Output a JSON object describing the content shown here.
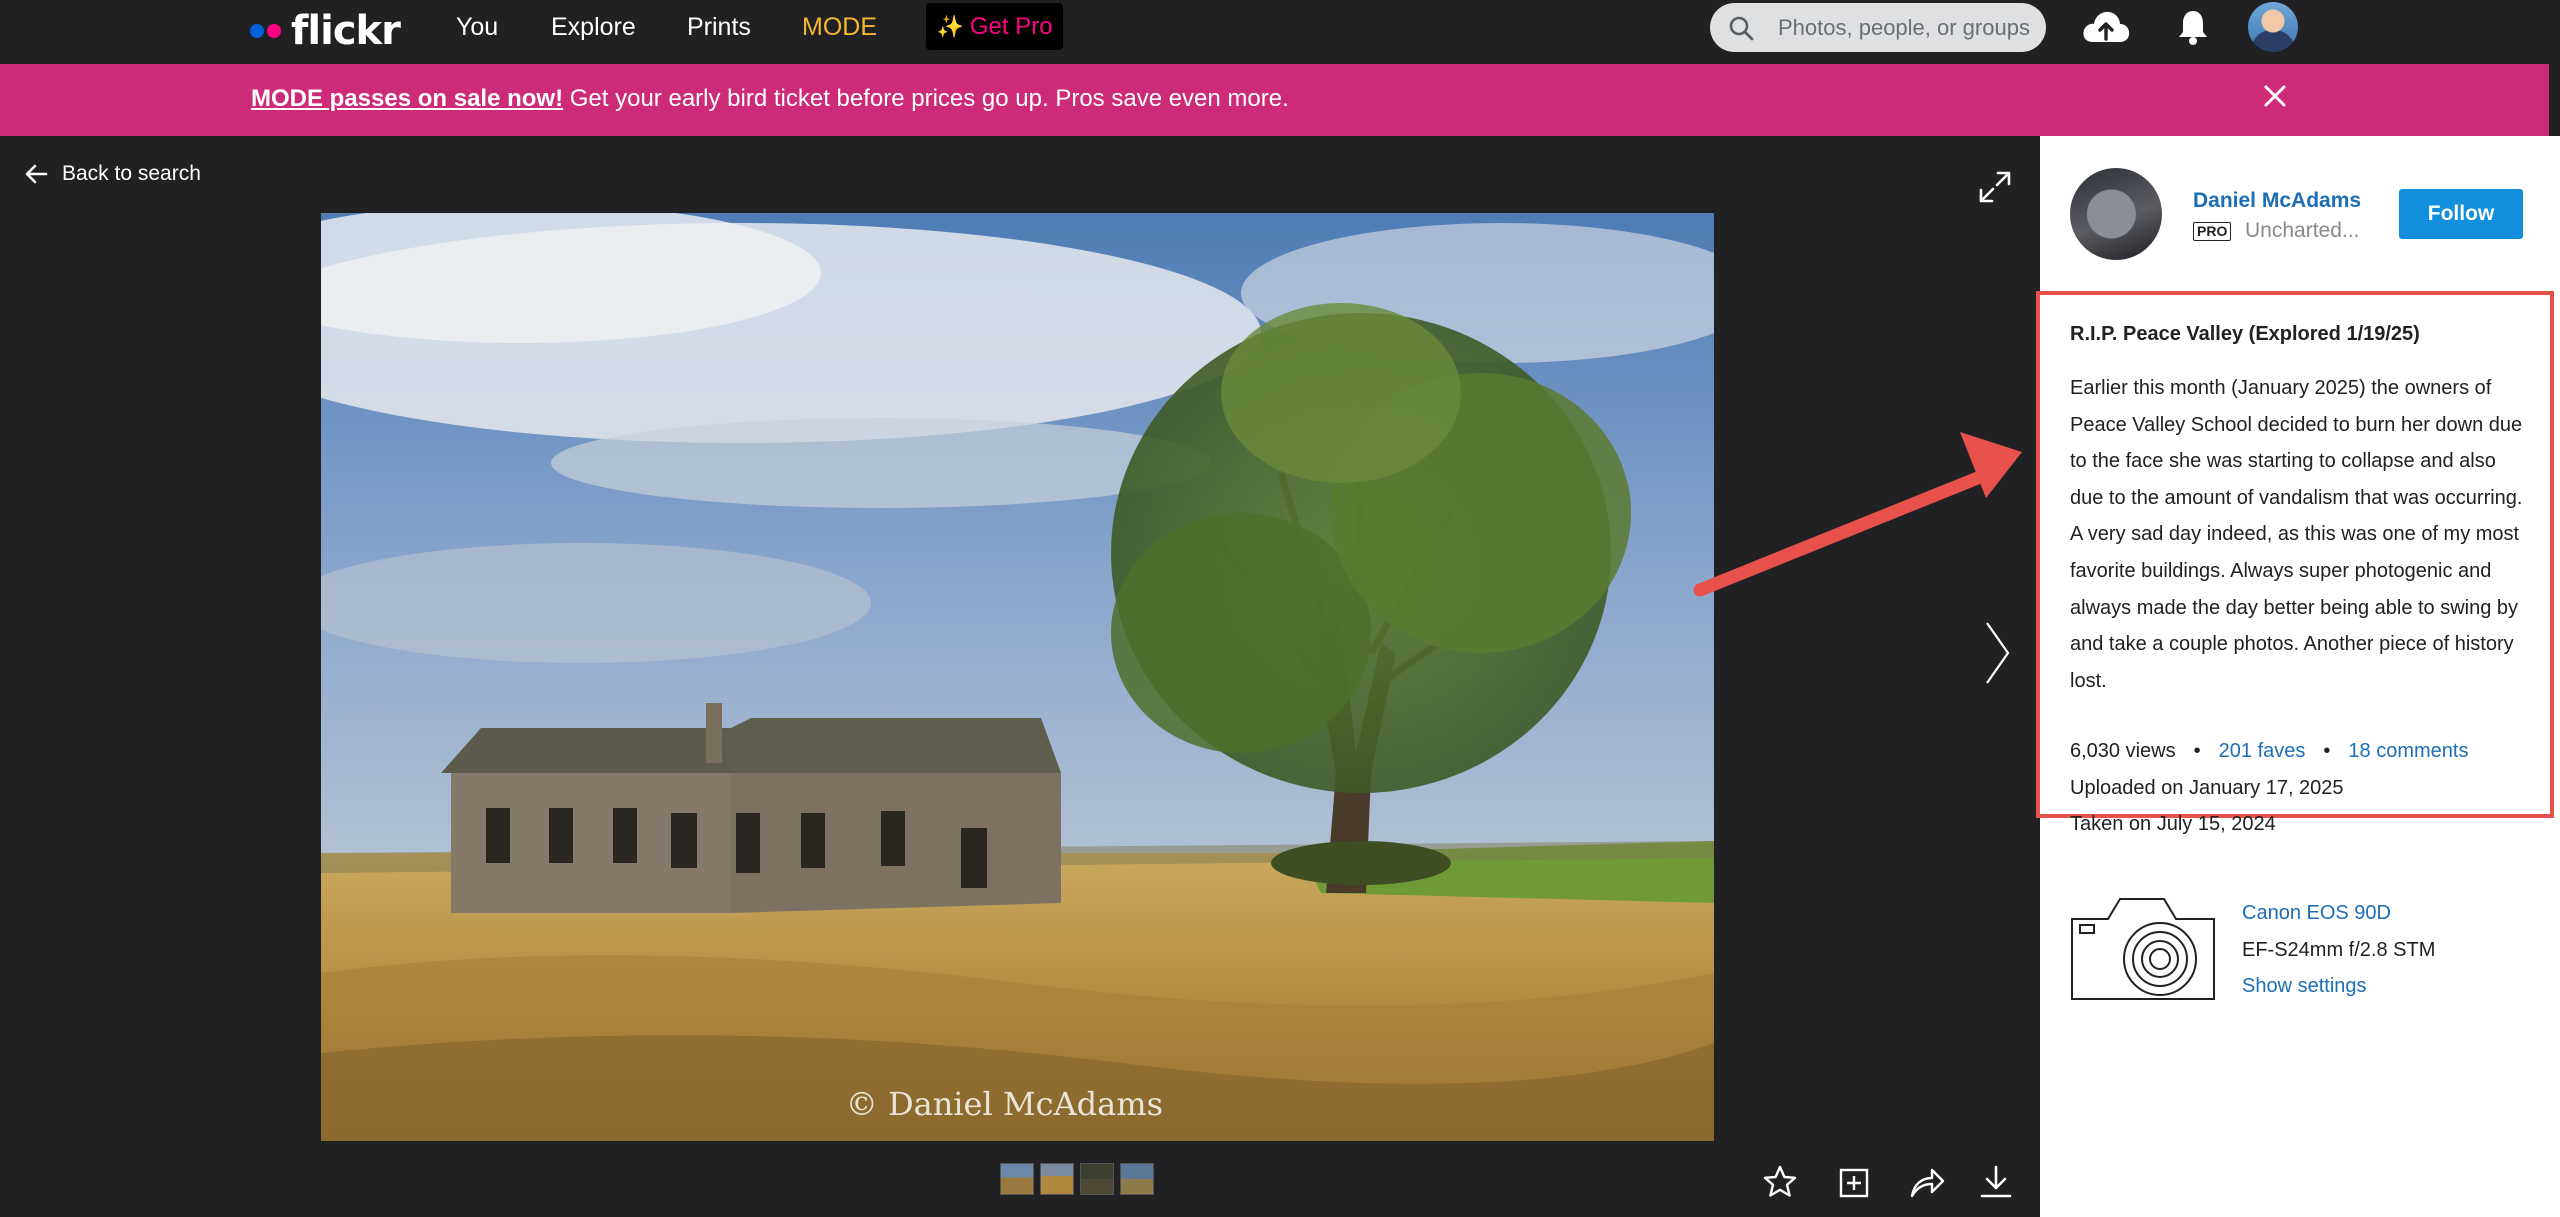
{
  "nav": {
    "logo": "flickr",
    "links": [
      "You",
      "Explore",
      "Prints",
      "MODE"
    ],
    "get_pro": "Get Pro",
    "search_placeholder": "Photos, people, or groups"
  },
  "banner": {
    "link_text": "MODE passes on sale now!",
    "text": " Get your early bird ticket before prices go up. Pros save even more."
  },
  "viewer": {
    "back_label": "Back to search",
    "watermark": "© Daniel McAdams"
  },
  "owner": {
    "name": "Daniel McAdams",
    "badge": "PRO",
    "subtitle": "Uncharted...",
    "follow_label": "Follow"
  },
  "photo": {
    "title": "R.I.P. Peace Valley (Explored 1/19/25)",
    "description": "Earlier this month (January 2025) the owners of Peace Valley School decided to burn her down due to the face she was starting to collapse and also due to the amount of vandalism that was occurring. A very sad day indeed, as this was one of my most favorite buildings. Always super photogenic and always made the day better being able to swing by and take a couple photos. Another piece of history lost.",
    "views": "6,030 views",
    "faves": "201 faves",
    "comments": "18 comments",
    "uploaded": "Uploaded on January 17, 2025",
    "taken": "Taken on July 15, 2024"
  },
  "exif": {
    "camera": "Canon EOS 90D",
    "lens": "EF-S24mm f/2.8 STM",
    "settings_link": "Show settings"
  },
  "colors": {
    "brand_blue": "#0063dc",
    "brand_pink": "#ff0084",
    "banner": "#cd2b77",
    "link": "#1c6eb7",
    "follow": "#128fdc",
    "highlight": "#e8514c",
    "mode": "#f5b82e"
  }
}
